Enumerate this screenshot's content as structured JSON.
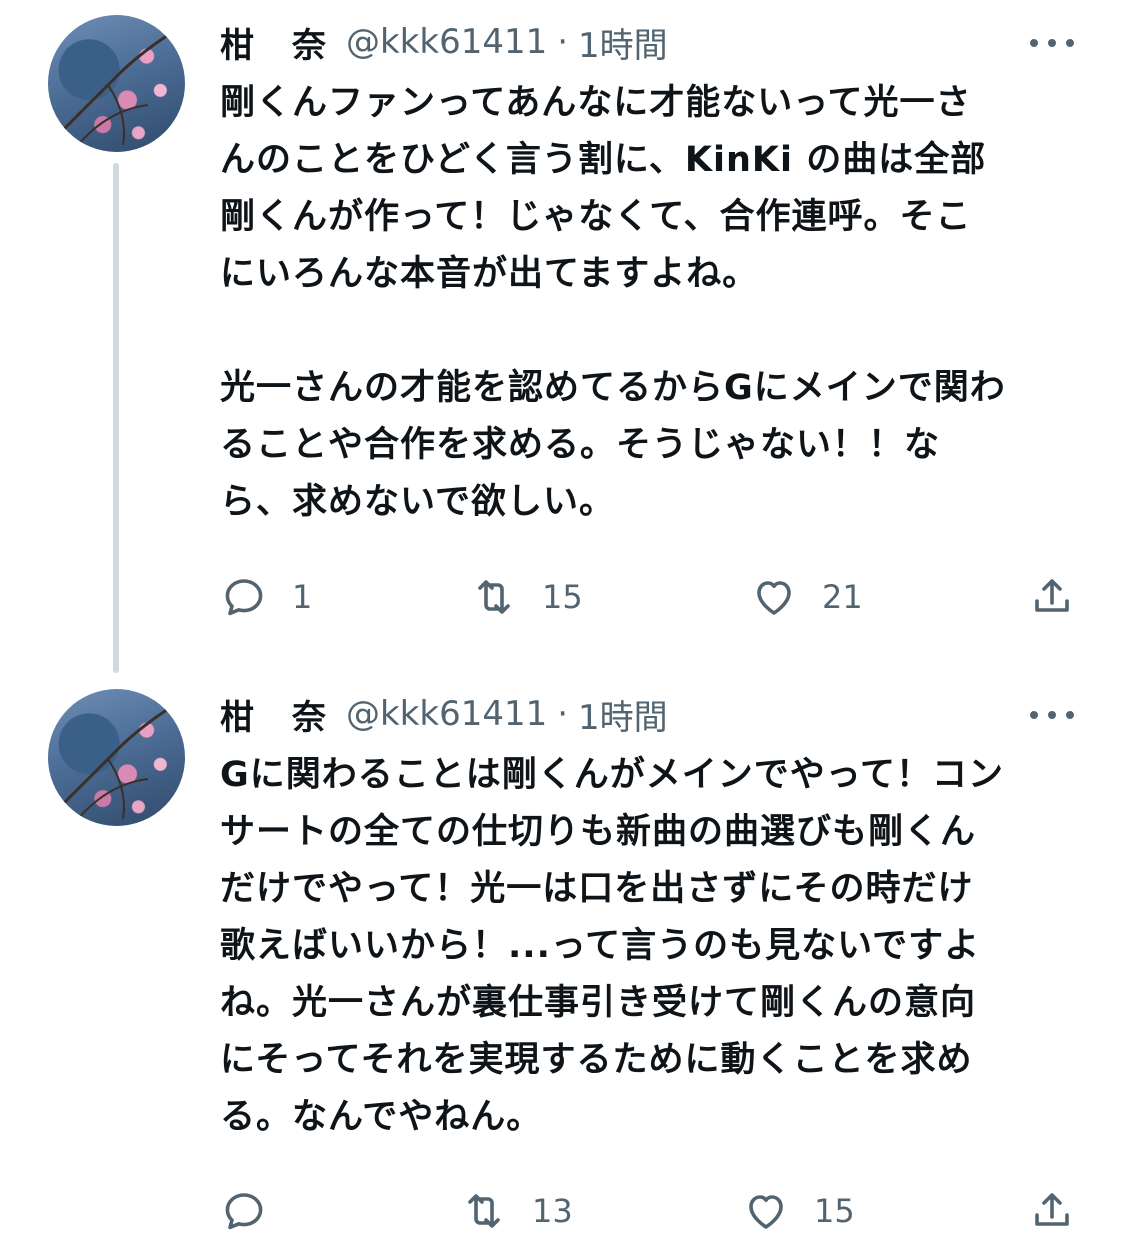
{
  "tweets": [
    {
      "author": {
        "name": "柑　奈",
        "handle": "@kkk61411"
      },
      "separator": "·",
      "time": "1時間",
      "text": "剛くんファンってあんなに才能ないって光一さ\nんのことをひどく言う割に、KinKi の曲は全部\n剛くんが作って！じゃなくて、合作連呼。そこ\nにいろんな本音が出てますよね。\n\n光一さんの才能を認めてるからGにメインで関わ\nることや合作を求める。そうじゃない！！な\nら、求めないで欲しい。",
      "stats": {
        "replies": "1",
        "retweets": "15",
        "likes": "21"
      }
    },
    {
      "author": {
        "name": "柑　奈",
        "handle": "@kkk61411"
      },
      "separator": "·",
      "time": "1時間",
      "text": "Gに関わることは剛くんがメインでやって！コン\nサートの全ての仕切りも新曲の曲選びも剛くん\nだけでやって！光一は口を出さずにその時だけ\n歌えばいいから！...って言うのも見ないですよ\nね。光一さんが裏仕事引き受けて剛くんの意向\nにそってそれを実現するために動くことを求め\nる。なんでやねん。",
      "stats": {
        "replies": "",
        "retweets": "13",
        "likes": "15"
      }
    }
  ],
  "icons": {
    "reply": "reply-icon",
    "retweet": "retweet-icon",
    "like": "heart-icon",
    "share": "share-icon",
    "more": "more-icon"
  },
  "colors": {
    "text": "#0f1419",
    "muted": "#536471",
    "thread_line": "#cfd9de",
    "background": "#ffffff"
  }
}
